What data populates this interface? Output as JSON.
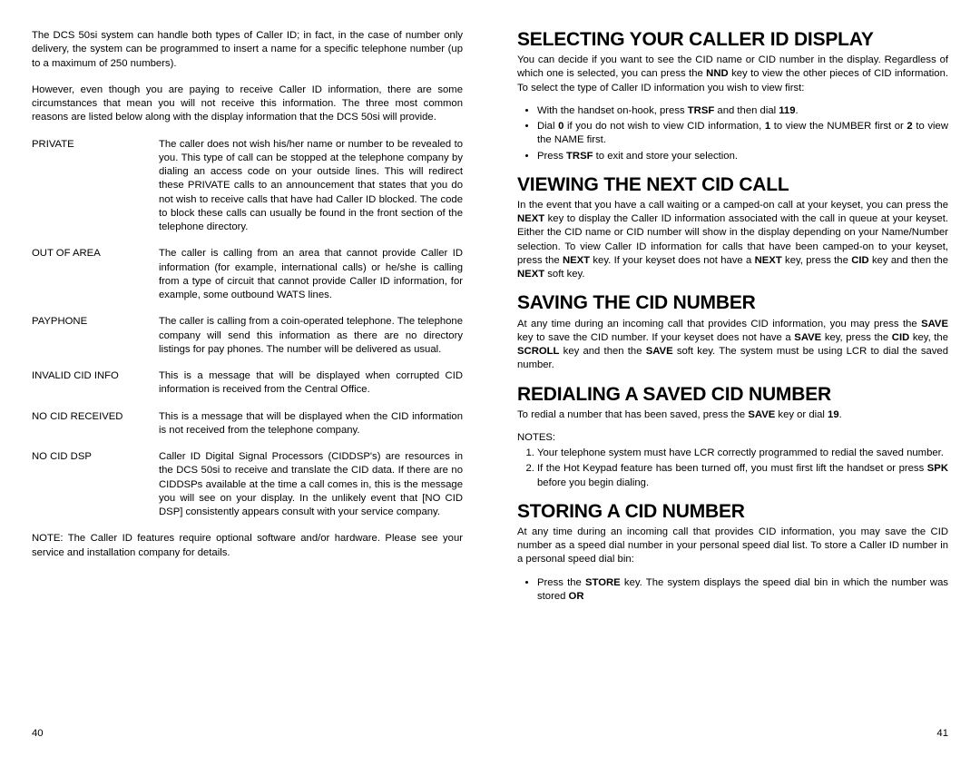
{
  "left": {
    "intro1": "The DCS 50si system can handle both types of Caller ID; in fact, in the case of number only delivery, the system can be programmed to insert a name for a specific telephone number (up to a maximum of 250 numbers).",
    "intro2": "However, even though you are paying to receive Caller ID information, there are some circumstances that mean you will not receive this information. The three most common reasons are listed below along with the display information that the DCS 50si will provide.",
    "defs": [
      {
        "term": "PRIVATE",
        "desc": "The caller does not wish his/her name or number to be revealed to you. This type of call can be stopped at the telephone company by dialing an access code on your outside lines. This will redirect these PRIVATE calls to an announcement that states that you do not wish to receive calls that have had Caller ID blocked. The code to block these calls can usually be found in the front section of the telephone directory."
      },
      {
        "term": "OUT OF AREA",
        "desc": "The caller is calling from an area that cannot provide Caller ID information (for example, international calls) or he/she is calling from a type of circuit that cannot provide Caller ID information, for example, some outbound WATS lines."
      },
      {
        "term": "PAYPHONE",
        "desc": "The caller is calling from a coin-operated telephone. The telephone company will send this information as there are no directory listings for pay phones. The number will be delivered as usual."
      },
      {
        "term": "INVALID CID INFO",
        "desc": "This is a message that will be displayed when corrupted CID information is received from the Central Office."
      },
      {
        "term": "NO CID RECEIVED",
        "desc": "This is a message that will be displayed when the CID information is not received from the telephone company."
      },
      {
        "term": "NO CID DSP",
        "desc": "Caller ID Digital Signal Processors (CIDDSP's) are resources in the DCS 50si to receive and translate the CID data. If there are no CIDDSPs available at the time a call comes in, this is the message you will see on your display. In the unlikely event that [NO CID DSP] consistently appears consult with your service company."
      }
    ],
    "note": "NOTE: The Caller ID features require optional software and/or hardware. Please see your service and installation company for details.",
    "pagenum": "40"
  },
  "right": {
    "sec1": {
      "title": "SELECTING YOUR CALLER ID DISPLAY",
      "body_pre": "You can decide if you want to see the CID name or CID number in the display. Regardless of which one is selected, you can press the ",
      "nnd": "NND",
      "body_post": " key to view the other pieces of CID information. To select the type of Caller ID information you wish to view first:",
      "b1_pre": "With the handset on-hook, press ",
      "b1_trsf": "TRSF",
      "b1_mid": " and then dial ",
      "b1_119": "119",
      "b1_post": ".",
      "b2_pre": "Dial ",
      "b2_0": "0",
      "b2_mid1": " if you do not wish to view CID information, ",
      "b2_1": "1",
      "b2_mid2": " to view the NUMBER first or ",
      "b2_2": "2",
      "b2_mid3": " to view the NAME first.",
      "b3_pre": "Press ",
      "b3_trsf": "TRSF",
      "b3_post": " to exit and store your selection."
    },
    "sec2": {
      "title": "VIEWING THE NEXT CID CALL",
      "p_pre": "In the event that you have a call waiting or a camped-on call at your keyset, you can press the ",
      "next1": "NEXT",
      "p_mid1": " key to display the Caller ID information associated with the call in queue at your keyset. Either the CID name or CID number will show in the display depending on your Name/Number selection. To view Caller ID information for calls that have been camped-on to your keyset, press the ",
      "next2": "NEXT",
      "p_mid2": " key. If your keyset does not have a ",
      "next3": "NEXT",
      "p_mid3": " key, press the ",
      "cid": "CID",
      "p_mid4": " key and then the ",
      "next4": "NEXT",
      "p_post": " soft key."
    },
    "sec3": {
      "title": "SAVING THE CID NUMBER",
      "p_pre": "At any time during an incoming call that provides CID information, you may press the ",
      "save1": "SAVE",
      "p_mid1": " key to save the CID number. If your keyset does not have a ",
      "save2": "SAVE",
      "p_mid2": " key, press the ",
      "cid": "CID",
      "p_mid3": " key, the ",
      "scroll": " SCROLL",
      "p_mid4": " key and then the ",
      "save3": "SAVE",
      "p_post": " soft key. The system must be using LCR to dial the saved number."
    },
    "sec4": {
      "title": "REDIALING A SAVED CID NUMBER",
      "p_pre": "To redial a number that has been saved, press the ",
      "save": "SAVE",
      "p_mid": " key or dial ",
      "n19": "19",
      "p_post": ".",
      "notes_label": "NOTES:",
      "n1": "Your telephone system must have LCR correctly programmed to redial the saved number.",
      "n2_pre": "If the Hot Keypad feature has been turned off, you must first lift the handset or press ",
      "spk": "SPK",
      "n2_post": " before you begin dialing."
    },
    "sec5": {
      "title": "STORING A CID NUMBER",
      "p": "At any time during an incoming call that provides CID information, you may save the CID number as a speed dial number in your personal speed dial list. To store a Caller ID number in a personal speed dial bin:",
      "b1_pre": "Press the ",
      "store": "STORE",
      "b1_mid": " key. The system displays the speed dial bin in which the number was stored ",
      "or": "OR"
    },
    "pagenum": "41"
  }
}
